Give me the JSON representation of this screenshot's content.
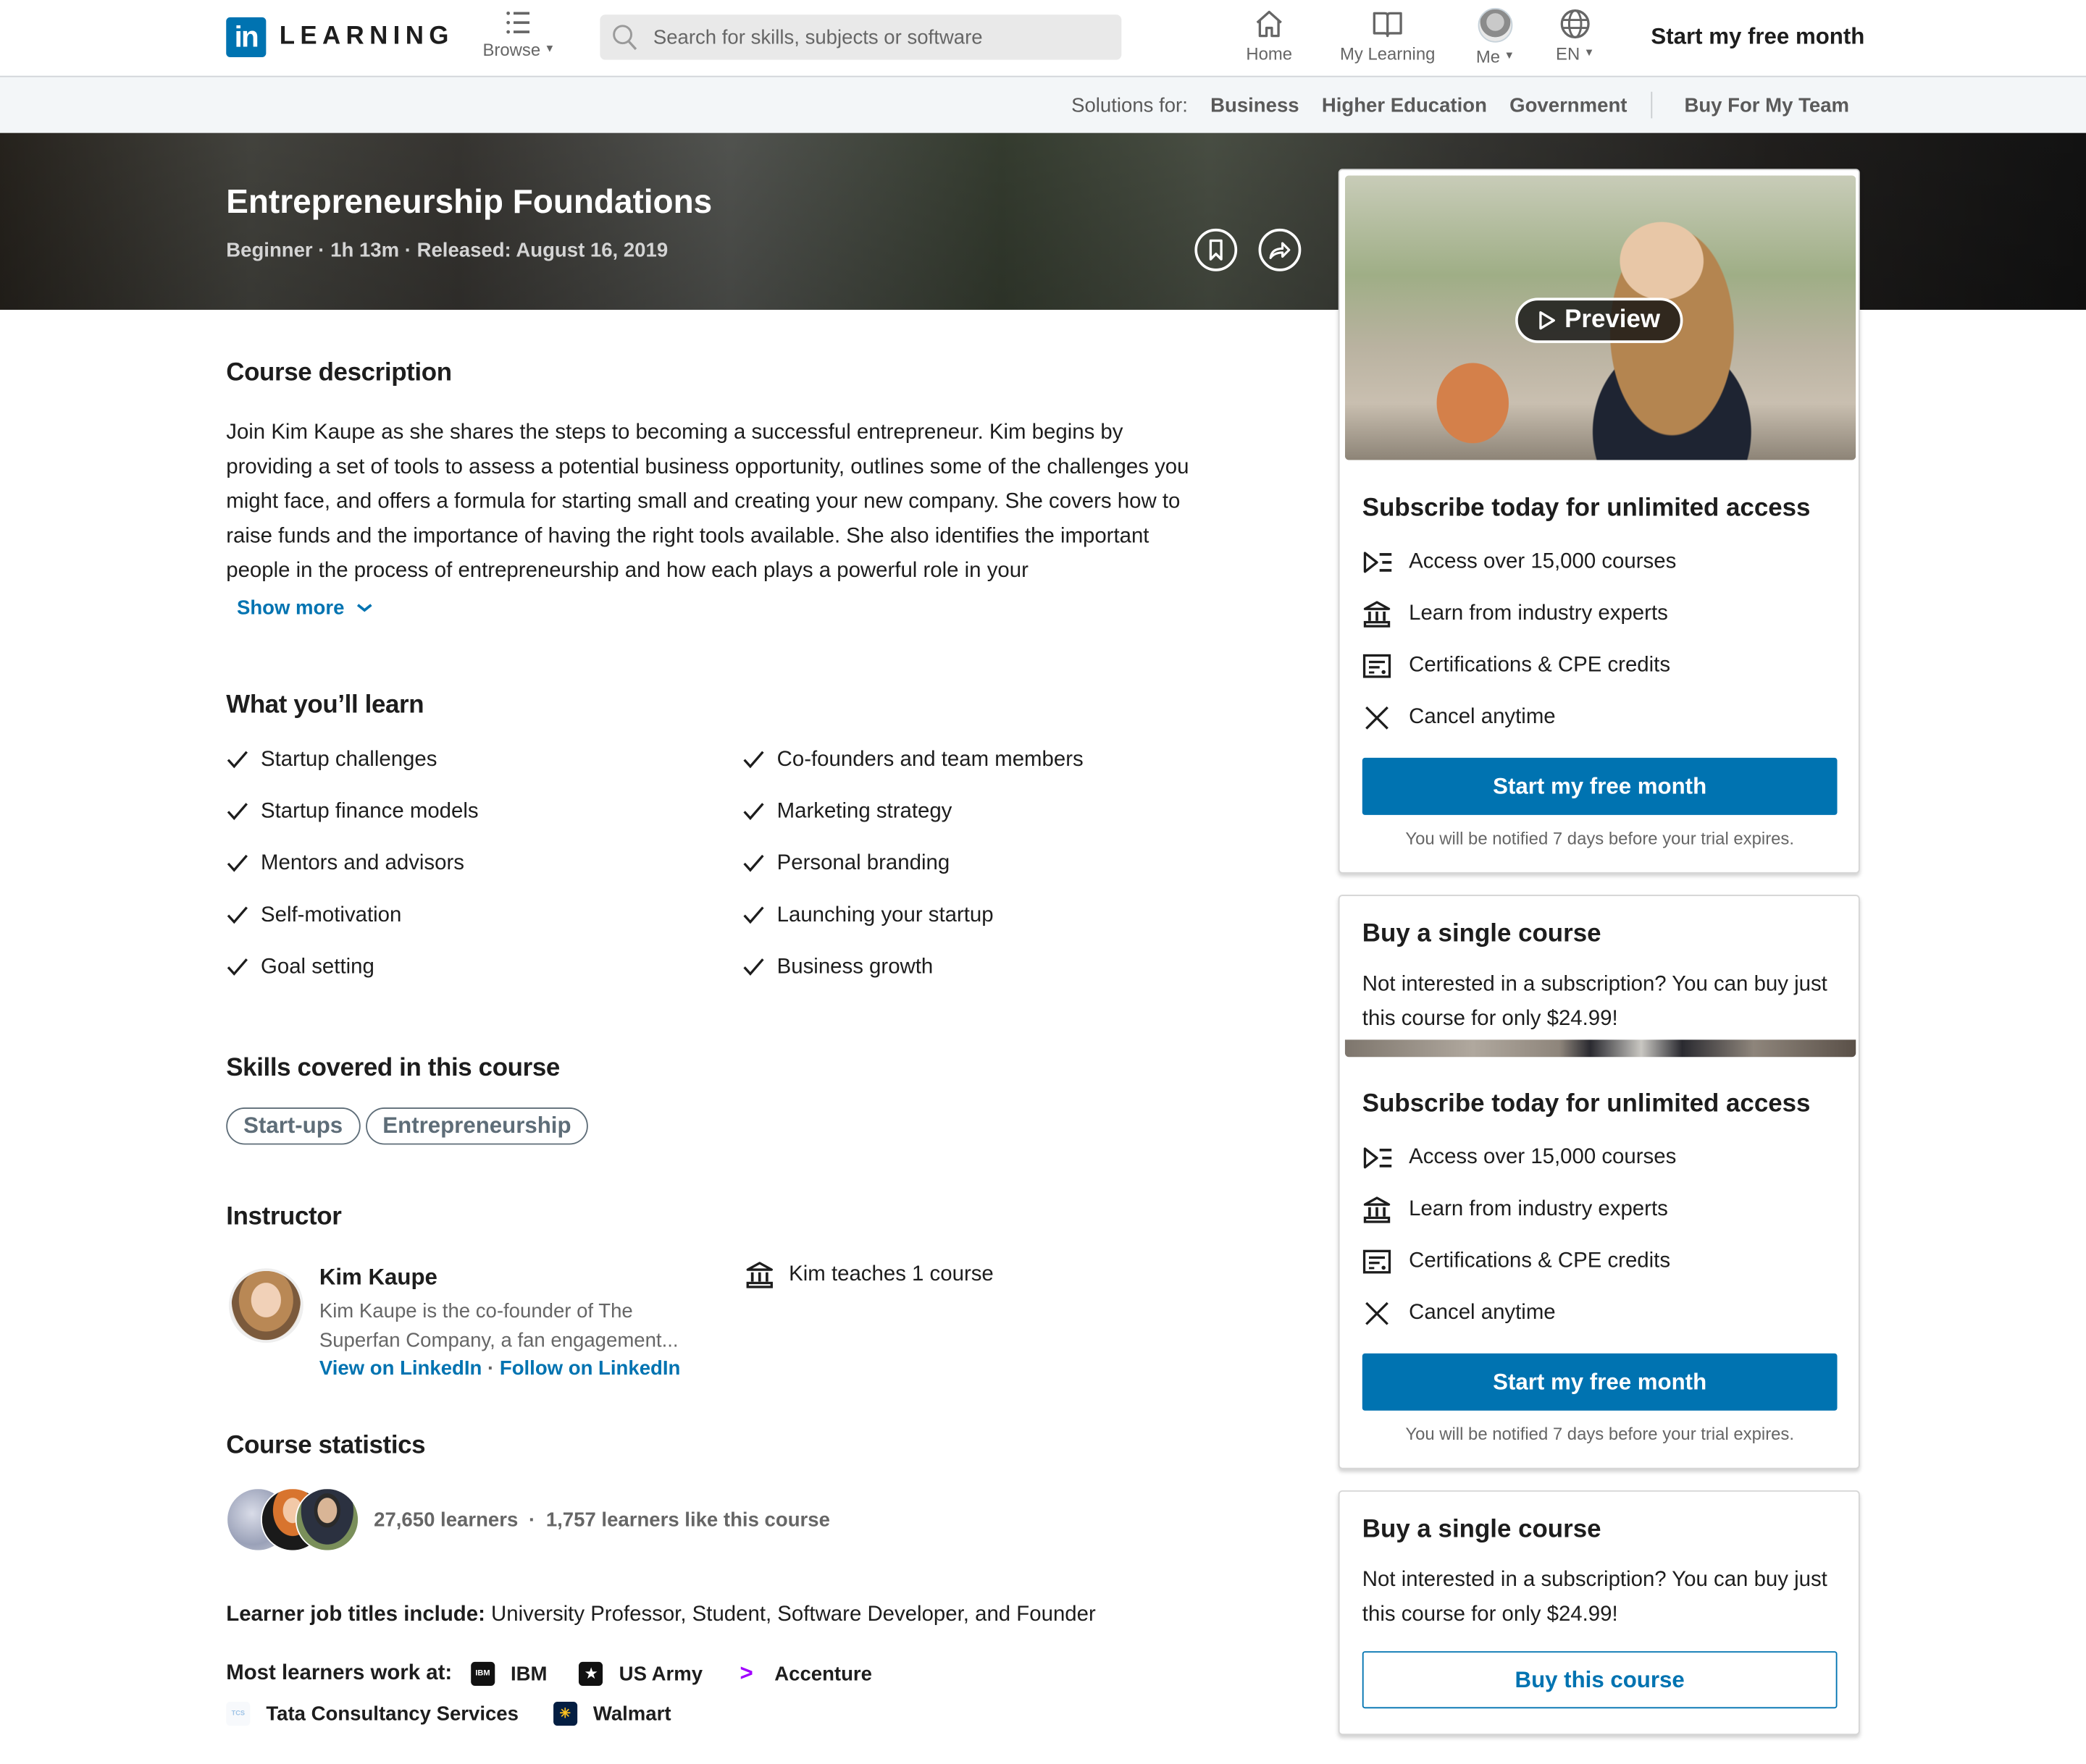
{
  "topnav": {
    "logo_mark": "in",
    "logo_text": "LEARNING",
    "browse_label": "Browse",
    "search_placeholder": "Search for skills, subjects or software",
    "items": [
      {
        "label": "Home",
        "icon": "home-icon"
      },
      {
        "label": "My Learning",
        "icon": "book-icon"
      },
      {
        "label": "Me",
        "icon": "avatar"
      },
      {
        "label": "EN",
        "icon": "globe-icon"
      }
    ],
    "cta": "Start my free month"
  },
  "solutions_bar": {
    "label": "Solutions for:",
    "links": [
      "Business",
      "Higher Education",
      "Government"
    ],
    "team_link": "Buy For My Team"
  },
  "hero": {
    "title": "Entrepreneurship Foundations",
    "meta": "Beginner · 1h 13m · Released: August 16, 2019"
  },
  "description": {
    "heading": "Course description",
    "text": "Join Kim Kaupe as she shares the steps to becoming a successful entrepreneur. Kim begins by providing a set of tools to assess a potential business opportunity, outlines some of the challenges you might face, and offers a formula for starting small and creating your new company. She covers how to raise funds and the importance of having the right tools available. She also identifies the important people in the process of entrepreneurship and how each plays a powerful role in your",
    "show_more": "Show more"
  },
  "learn": {
    "heading": "What you’ll learn",
    "items": [
      "Startup challenges",
      "Co-founders and team members",
      "Startup finance models",
      "Marketing strategy",
      "Mentors and advisors",
      "Personal branding",
      "Self-motivation",
      "Launching your startup",
      "Goal setting",
      "Business growth"
    ]
  },
  "skills": {
    "heading": "Skills covered in this course",
    "items": [
      "Start-ups",
      "Entrepreneurship"
    ]
  },
  "instructor": {
    "heading": "Instructor",
    "name": "Kim Kaupe",
    "bio": "Kim Kaupe is the co-founder of The Superfan Company, a fan engagement...",
    "view_link": "View on LinkedIn",
    "separator": "·",
    "follow_link": "Follow on LinkedIn",
    "teaches": "Kim teaches 1 course"
  },
  "stats": {
    "heading": "Course statistics",
    "learners": "27,650 learners",
    "separator": "·",
    "likes": "1,757 learners like this course",
    "job_titles_label": "Learner job titles include:",
    "job_titles": "University Professor, Student, Software Developer, and Founder",
    "work_label": "Most learners work at:",
    "companies": [
      {
        "name": "IBM",
        "color": "#111111",
        "mark": "IBM"
      },
      {
        "name": "US Army",
        "color": "#111111",
        "mark": "★"
      },
      {
        "name": "Accenture",
        "color": "#a100ff",
        "mark": ">"
      },
      {
        "name": "Tata Consultancy Services",
        "color": "#9ec3e6",
        "mark": "TCS"
      },
      {
        "name": "Walmart",
        "color": "#041e42",
        "mark": "✳"
      }
    ]
  },
  "sidebar": {
    "preview_label": "Preview",
    "subscribe_cards": [
      {
        "title": "Subscribe today for unlimited access",
        "features": [
          {
            "icon": "courses-icon",
            "label": "Access over 15,000 courses"
          },
          {
            "icon": "institution-icon",
            "label": "Learn from industry experts"
          },
          {
            "icon": "certificate-icon",
            "label": "Certifications & CPE credits"
          },
          {
            "icon": "close-icon",
            "label": "Cancel anytime"
          }
        ],
        "cta": "Start my free month",
        "notice": "You will be notified 7 days before your trial expires."
      },
      {
        "title": "Subscribe today for unlimited access",
        "features": [
          {
            "icon": "courses-icon",
            "label": "Access over 15,000 courses"
          },
          {
            "icon": "institution-icon",
            "label": "Learn from industry experts"
          },
          {
            "icon": "certificate-icon",
            "label": "Certifications & CPE credits"
          },
          {
            "icon": "close-icon",
            "label": "Cancel anytime"
          }
        ],
        "cta": "Start my free month",
        "notice": "You will be notified 7 days before your trial expires."
      }
    ],
    "buy_cards": [
      {
        "title": "Buy a single course",
        "text": "Not interested in a subscription? You can buy just this course for only $24.99!"
      },
      {
        "title": "Buy a single course",
        "text": "Not interested in a subscription? You can buy just this course for only $24.99!",
        "cta": "Buy this course"
      }
    ]
  },
  "colors": {
    "brand": "#0073b1",
    "pill": "#5e6d78",
    "solutions_bg": "#f3f6f8"
  }
}
